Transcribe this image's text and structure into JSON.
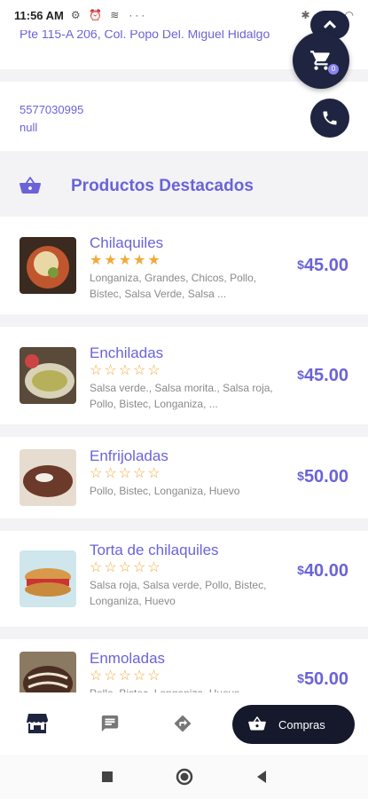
{
  "status_bar": {
    "time": "11:56 AM",
    "status_icons": "⚙ ⏰ ≋",
    "more": "···"
  },
  "address": {
    "text": "Pte 115-A 206, Col. Popo Del. Miguel Hidalgo"
  },
  "contact": {
    "phone": "5577030995",
    "extra": "null"
  },
  "cart": {
    "badge": "0"
  },
  "section": {
    "title": "Productos Destacados"
  },
  "products": [
    {
      "name": "Chilaquiles",
      "stars": "★★★★★",
      "rating": 5,
      "desc": "Longaniza, Grandes, Chicos, Pollo, Bistec, Salsa Verde, Salsa ...",
      "currency": "$",
      "price": "45.00"
    },
    {
      "name": "Enchiladas",
      "stars": "☆☆☆☆☆",
      "rating": 0,
      "desc": "Salsa verde., Salsa morita., Salsa roja, Pollo, Bistec, Longaniza, ...",
      "currency": "$",
      "price": "45.00"
    },
    {
      "name": "Enfrijoladas",
      "stars": "☆☆☆☆☆",
      "rating": 0,
      "desc": "Pollo, Bistec, Longaniza, Huevo",
      "currency": "$",
      "price": "50.00"
    },
    {
      "name": "Torta de chilaquiles",
      "stars": "☆☆☆☆☆",
      "rating": 0,
      "desc": "Salsa roja, Salsa verde, Pollo, Bistec, Longaniza, Huevo",
      "currency": "$",
      "price": "40.00"
    },
    {
      "name": "Enmoladas",
      "stars": "☆☆☆☆☆",
      "rating": 0,
      "desc": "Pollo, Bistec, Longaniza, Huevo",
      "currency": "$",
      "price": "50.00"
    }
  ],
  "bottom_nav": {
    "compras_label": "Compras"
  },
  "colors": {
    "accent": "#6a63d8",
    "dark": "#1f2540",
    "star": "#f2a93b"
  }
}
